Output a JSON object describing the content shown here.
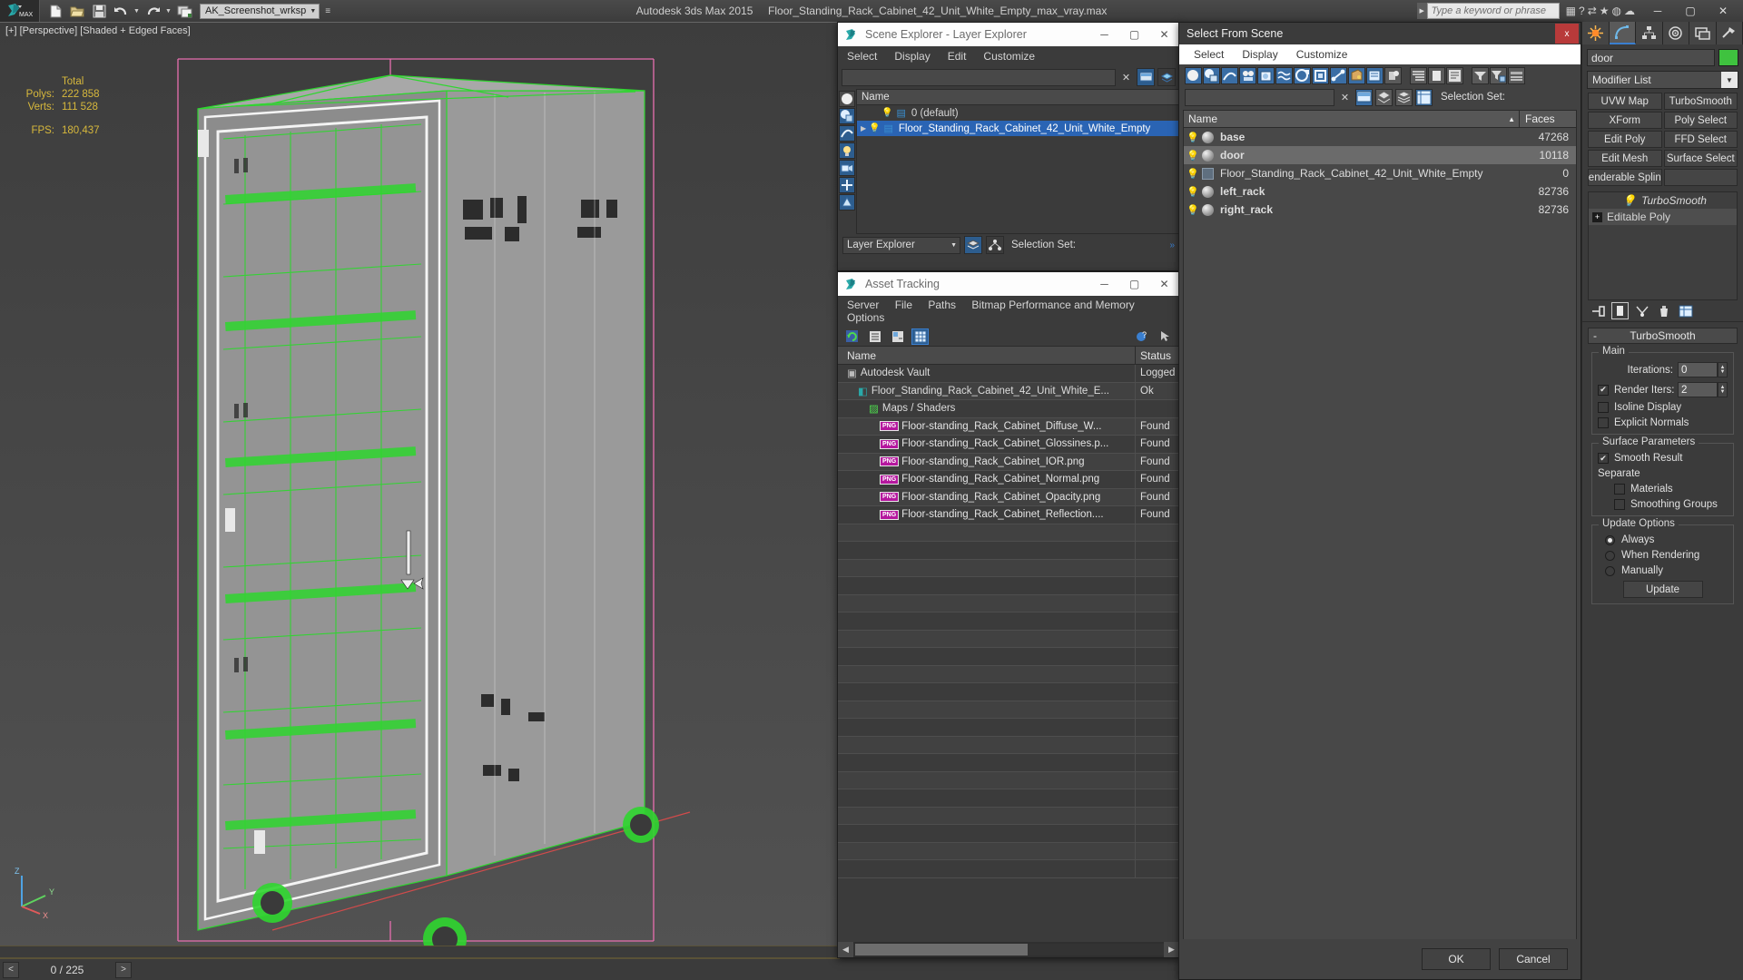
{
  "titlebar": {
    "app_title": "Autodesk 3ds Max  2015",
    "file_name": "Floor_Standing_Rack_Cabinet_42_Unit_White_Empty_max_vray.max",
    "workspace": "AK_Screenshot_wrksp",
    "search_placeholder": "Type a keyword or phrase",
    "icons": [
      "new-file-icon",
      "open-file-icon",
      "save-icon",
      "undo-icon",
      "redo-icon",
      "set-project-icon"
    ],
    "window_buttons": [
      "minimize",
      "maximize",
      "close"
    ]
  },
  "viewport": {
    "label": "[+] [Perspective] [Shaded + Edged Faces]",
    "stats": {
      "header": "Total",
      "polys_label": "Polys:",
      "polys_value": "222 858",
      "verts_label": "Verts:",
      "verts_value": "111 528",
      "fps_label": "FPS:",
      "fps_value": "180,437"
    },
    "axis": {
      "z": "Z",
      "y": "Y",
      "x": "X"
    }
  },
  "scene_explorer": {
    "title": "Scene Explorer - Layer Explorer",
    "menu": [
      "Select",
      "Display",
      "Edit",
      "Customize"
    ],
    "search_value": "",
    "column_header": "Name",
    "rows": [
      {
        "name": "0 (default)",
        "selected": false,
        "expandable": false
      },
      {
        "name": "Floor_Standing_Rack_Cabinet_42_Unit_White_Empty",
        "selected": true,
        "expandable": true
      }
    ],
    "footer_combo": "Layer Explorer",
    "selection_set_label": "Selection Set:"
  },
  "asset_tracking": {
    "title": "Asset Tracking",
    "menu": [
      "Server",
      "File",
      "Paths",
      "Bitmap Performance and Memory",
      "Options"
    ],
    "columns": [
      "Name",
      "Status"
    ],
    "rows": [
      {
        "name": "Autodesk Vault",
        "status": "Logged",
        "icon": "vault-icon",
        "indent": 1
      },
      {
        "name": "Floor_Standing_Rack_Cabinet_42_Unit_White_E...",
        "status": "Ok",
        "icon": "max-file-icon",
        "indent": 2
      },
      {
        "name": "Maps / Shaders",
        "status": "",
        "icon": "maps-icon",
        "indent": 3
      },
      {
        "name": "Floor-standing_Rack_Cabinet_Diffuse_W...",
        "status": "Found",
        "icon": "png-icon",
        "indent": 4
      },
      {
        "name": "Floor-standing_Rack_Cabinet_Glossines.p...",
        "status": "Found",
        "icon": "png-icon",
        "indent": 4
      },
      {
        "name": "Floor-standing_Rack_Cabinet_IOR.png",
        "status": "Found",
        "icon": "png-icon",
        "indent": 4
      },
      {
        "name": "Floor-standing_Rack_Cabinet_Normal.png",
        "status": "Found",
        "icon": "png-icon",
        "indent": 4
      },
      {
        "name": "Floor-standing_Rack_Cabinet_Opacity.png",
        "status": "Found",
        "icon": "png-icon",
        "indent": 4
      },
      {
        "name": "Floor-standing_Rack_Cabinet_Reflection....",
        "status": "Found",
        "icon": "png-icon",
        "indent": 4
      }
    ],
    "empty_row_count": 20
  },
  "select_from_scene": {
    "title": "Select From Scene",
    "close_label": "x",
    "menu": [
      "Select",
      "Display",
      "Customize"
    ],
    "search_value": "",
    "selection_set_label": "Selection Set:",
    "columns": {
      "name": "Name",
      "faces": "Faces",
      "sort": "▲"
    },
    "rows": [
      {
        "name": "base",
        "faces": "47268",
        "bold": true,
        "selected": false,
        "icon": "sphere-icon"
      },
      {
        "name": "door",
        "faces": "10118",
        "bold": true,
        "selected": true,
        "icon": "sphere-icon"
      },
      {
        "name": "Floor_Standing_Rack_Cabinet_42_Unit_White_Empty",
        "faces": "0",
        "bold": false,
        "selected": false,
        "icon": "group-icon"
      },
      {
        "name": "left_rack",
        "faces": "82736",
        "bold": true,
        "selected": false,
        "icon": "sphere-icon"
      },
      {
        "name": "right_rack",
        "faces": "82736",
        "bold": true,
        "selected": false,
        "icon": "sphere-icon"
      }
    ],
    "ok_label": "OK",
    "cancel_label": "Cancel"
  },
  "command_panel": {
    "tabs": [
      "create-tab",
      "modify-tab",
      "hierarchy-tab",
      "motion-tab",
      "display-tab",
      "utilities-tab"
    ],
    "active_tab_index": 1,
    "object_name": "door",
    "object_color": "#3fc23f",
    "modifier_list_label": "Modifier List",
    "modifier_buttons": [
      "UVW Map",
      "TurboSmooth",
      "XForm",
      "Poly Select",
      "Edit Poly",
      "FFD Select",
      "Edit Mesh",
      "Surface Select",
      "enderable Splin",
      ""
    ],
    "stack": [
      {
        "label": "TurboSmooth",
        "italic": true,
        "lit": false
      },
      {
        "label": "Editable Poly",
        "italic": false,
        "lit": true
      }
    ],
    "rollout_title": "TurboSmooth",
    "groups": [
      {
        "label": "Main",
        "iterations_label": "Iterations:",
        "iterations_value": "0",
        "render_iters_label": "Render Iters:",
        "render_iters_value": "2",
        "render_iters_checked": true,
        "isoline_label": "Isoline Display",
        "isoline_checked": false,
        "explicit_label": "Explicit Normals",
        "explicit_checked": false
      },
      {
        "label": "Surface Parameters",
        "smooth_result_label": "Smooth Result",
        "smooth_result_checked": true,
        "separate_label": "Separate",
        "materials_label": "Materials",
        "materials_checked": false,
        "smoothing_groups_label": "Smoothing Groups",
        "smoothing_groups_checked": false
      },
      {
        "label": "Update Options",
        "options": [
          {
            "label": "Always",
            "selected": true
          },
          {
            "label": "When Rendering",
            "selected": false
          },
          {
            "label": "Manually",
            "selected": false
          }
        ],
        "update_button": "Update"
      }
    ]
  },
  "statusbar": {
    "prev_label": "<",
    "next_label": ">",
    "frame_counter": "0 / 225"
  },
  "colors": {
    "accent_blue": "#2a64b4",
    "viewport_bg": "#4b4b4b",
    "panel_bg": "#3b3b3b",
    "stat_yellow": "#d7b83c",
    "wire_green": "#2fd62f",
    "gizmo_pink": "#e86fb0"
  }
}
